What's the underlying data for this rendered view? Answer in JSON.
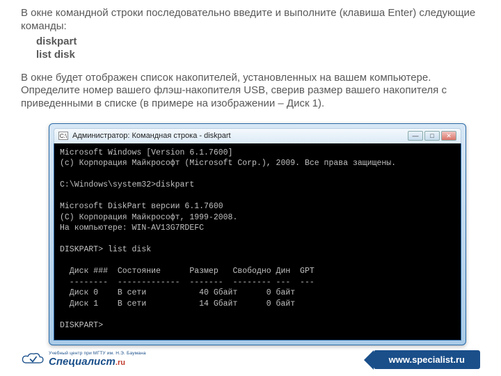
{
  "instruction": {
    "intro": "В окне командной строки последовательно введите и выполните (клавиша Enter) следующие команды:",
    "commands": [
      "diskpart",
      "list disk"
    ],
    "result": "В окне будет отображен список накопителей, установленных на вашем компьютере. Определите номер вашего флэш-накопителя USB, сверив размер вашего накопителя с приведенными в списке (в примере на изображении – Диск 1)."
  },
  "window": {
    "title": "Администратор: Командная строка - diskpart"
  },
  "console": {
    "line1": "Microsoft Windows [Version 6.1.7600]",
    "line2": "(c) Корпорация Майкрософт (Microsoft Corp.), 2009. Все права защищены.",
    "prompt1": "C:\\Windows\\system32>diskpart",
    "dp1": "Microsoft DiskPart версии 6.1.7600",
    "dp2": "(C) Корпорация Майкрософт, 1999-2008.",
    "dp3": "На компьютере: WIN-AV13G7RDEFC",
    "prompt2": "DISKPART> list disk",
    "header": "  Диск ###  Состояние      Размер   Свободно Дин  GPT",
    "sep": "  --------  -------------  -------  -------- ---  ---",
    "row0": "  Диск 0    В сети           40 Gбайт      0 байт",
    "row1": "  Диск 1    В сети           14 Gбайт      0 байт",
    "prompt3": "DISKPART>"
  },
  "footer": {
    "logo_small": "Учебный центр при МГТУ им. Н.Э. Баумана",
    "logo_main": "Специалист",
    "logo_suffix": ".ru",
    "site": "www.specialist.ru"
  }
}
